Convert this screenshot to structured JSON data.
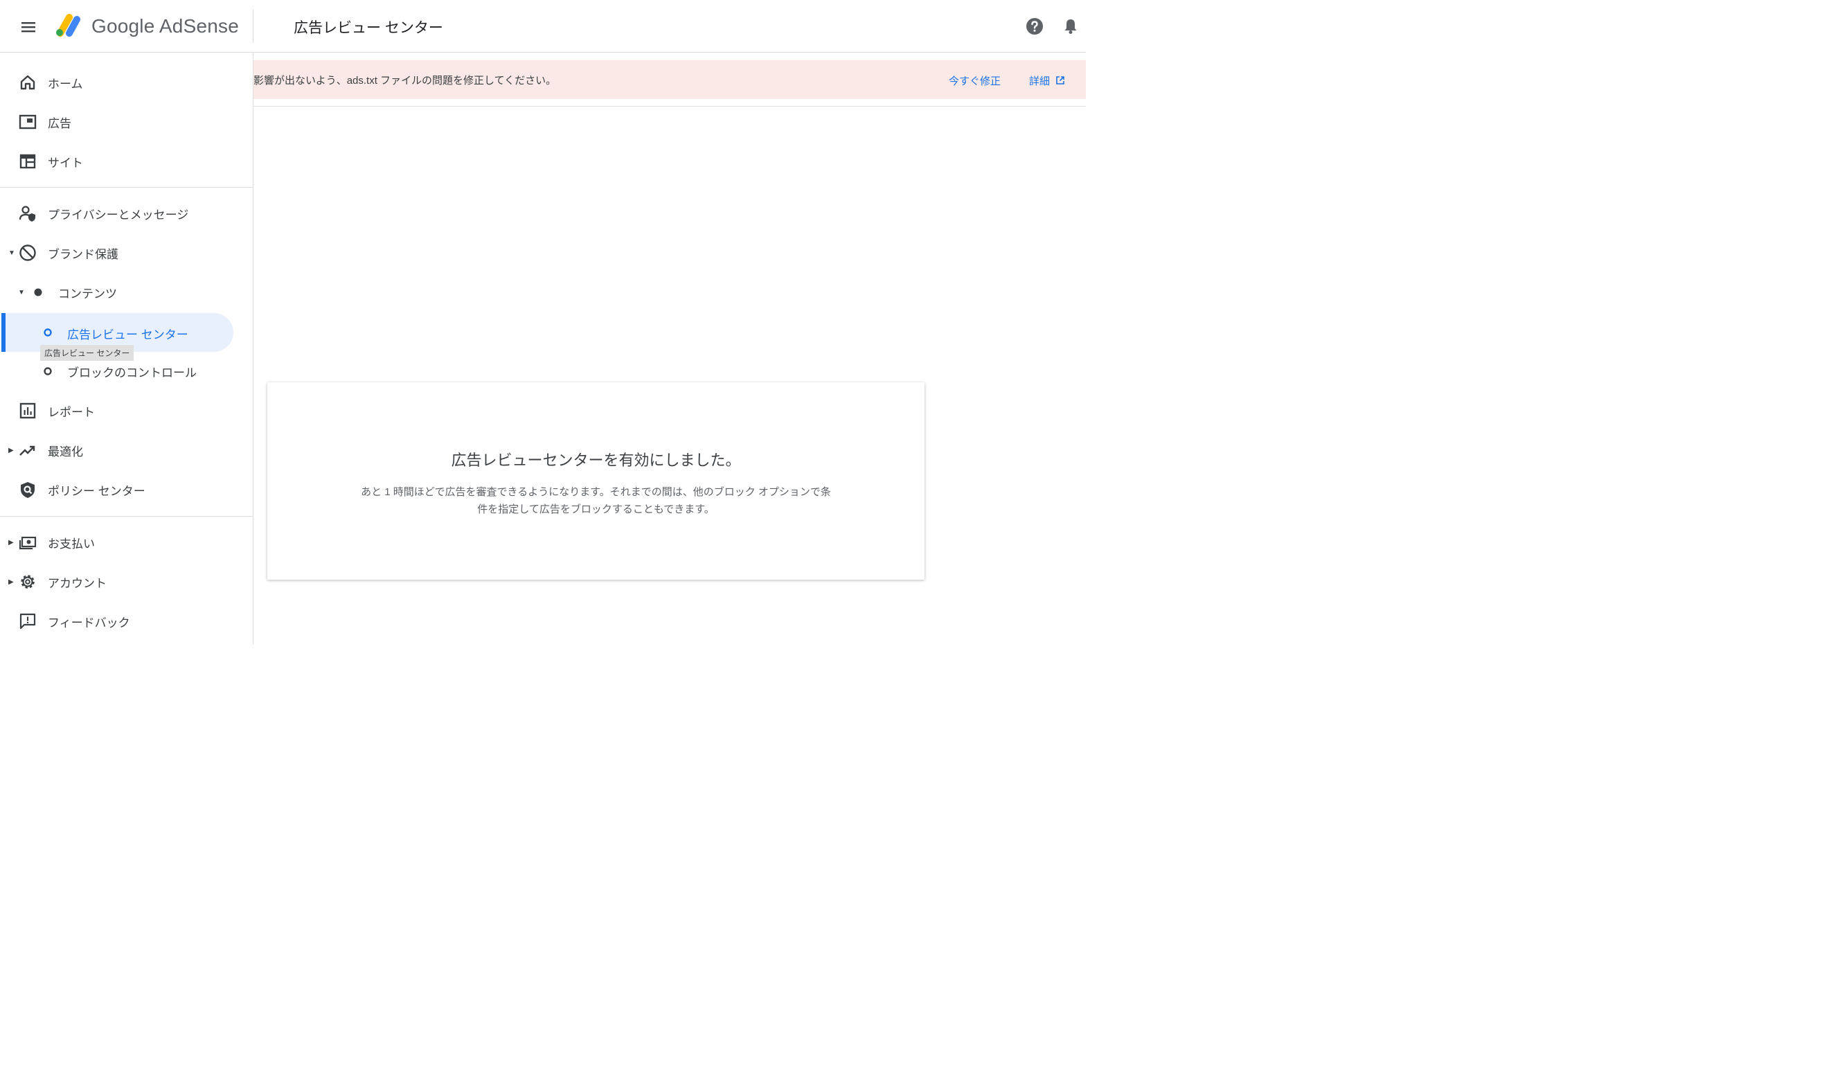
{
  "header": {
    "brand": "Google AdSense",
    "page_title": "広告レビュー センター",
    "icons": [
      "menu-icon",
      "help-icon",
      "bell-icon"
    ]
  },
  "sidebar": {
    "items": [
      {
        "label": "ホーム",
        "icon": "home-icon"
      },
      {
        "label": "広告",
        "icon": "ads-icon"
      },
      {
        "label": "サイト",
        "icon": "sites-icon"
      },
      {
        "label": "プライバシーとメッセージ",
        "icon": "privacy-icon"
      },
      {
        "label": "ブランド保護",
        "icon": "block-icon"
      },
      {
        "label": "コンテンツ",
        "icon": "dot-icon"
      },
      {
        "label": "広告レビュー センター",
        "icon": "circle-icon"
      },
      {
        "label": "ブロックのコントロール",
        "icon": "circle-icon"
      },
      {
        "label": "レポート",
        "icon": "report-icon"
      },
      {
        "label": "最適化",
        "icon": "trending-icon"
      },
      {
        "label": "ポリシー センター",
        "icon": "policy-icon"
      },
      {
        "label": "お支払い",
        "icon": "payments-icon"
      },
      {
        "label": "アカウント",
        "icon": "gear-icon"
      },
      {
        "label": "フィードバック",
        "icon": "feedback-icon"
      }
    ],
    "tooltip": "広告レビュー センター"
  },
  "banner": {
    "text": "影響が出ないよう、ads.txt ファイルの問題を修正してください。",
    "fix_now": "今すぐ修正",
    "details": "詳細"
  },
  "card": {
    "title": "広告レビューセンターを有効にしました。",
    "body": "あと 1 時間ほどで広告を審査できるようになります。それまでの間は、他のブロック オプションで条件を指定して広告をブロックすることもできます。"
  },
  "colors": {
    "accent": "#1a73e8",
    "banner_bg": "#fbe9e7",
    "active_bg": "#e8f0fe"
  }
}
